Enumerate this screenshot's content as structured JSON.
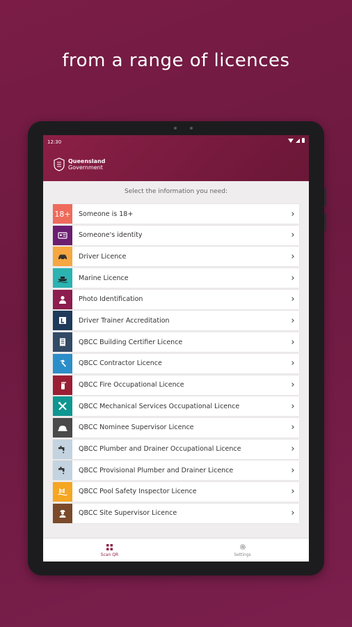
{
  "headline": "from a range of licences",
  "status": {
    "time": "12:30"
  },
  "logo": {
    "line1": "Queensland",
    "line2": "Government"
  },
  "instruction": "Select the information you need:",
  "items": [
    {
      "label": "Someone is 18+",
      "icon_text": "18+",
      "icon": "age-18-icon",
      "color": "#ee6b5c"
    },
    {
      "label": "Someone's identity",
      "icon": "id-card-icon",
      "color": "#6b1e6f"
    },
    {
      "label": "Driver Licence",
      "icon": "car-icon",
      "color": "#f6a741"
    },
    {
      "label": "Marine Licence",
      "icon": "boat-icon",
      "color": "#2bb3b1"
    },
    {
      "label": "Photo Identification",
      "icon": "person-icon",
      "color": "#8c1d4e"
    },
    {
      "label": "Driver Trainer Accreditation",
      "icon": "learner-plate-icon",
      "color": "#1f3a5a"
    },
    {
      "label": "QBCC Building Certifier Licence",
      "icon": "document-icon",
      "color": "#334a66"
    },
    {
      "label": "QBCC Contractor Licence",
      "icon": "hammer-icon",
      "color": "#2c8ec9"
    },
    {
      "label": "QBCC Fire Occupational Licence",
      "icon": "fire-extinguisher-icon",
      "color": "#9a1f35"
    },
    {
      "label": "QBCC Mechanical Services Occupational Licence",
      "icon": "tools-icon",
      "color": "#0f9690"
    },
    {
      "label": "QBCC Nominee Supervisor Licence",
      "icon": "hard-hat-icon",
      "color": "#4a4a4a"
    },
    {
      "label": "QBCC Plumber and Drainer Occupational Licence",
      "icon": "tap-icon",
      "color": "#c3d3df"
    },
    {
      "label": "QBCC Provisional Plumber and Drainer Licence",
      "icon": "tap-icon",
      "color": "#c3d3df"
    },
    {
      "label": "QBCC Pool Safety Inspector Licence",
      "icon": "pool-icon",
      "color": "#f5a623"
    },
    {
      "label": "QBCC Site Supervisor Licence",
      "icon": "supervisor-icon",
      "color": "#7a4a2a"
    }
  ],
  "nav": {
    "scan_label": "Scan QR",
    "settings_label": "Settings"
  },
  "colors": {
    "brand": "#8c1f45",
    "background": "#7a1c46"
  }
}
